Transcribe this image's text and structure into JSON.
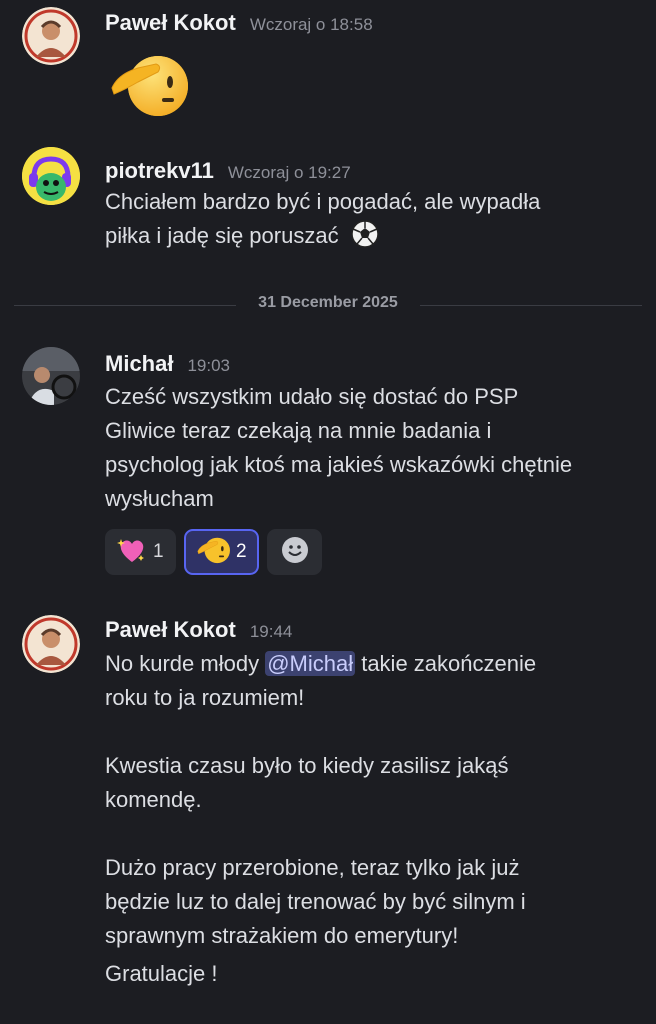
{
  "messages": [
    {
      "author": "Paweł Kokot",
      "time": "Wczoraj o 18:58",
      "emoji": "saluting-face"
    },
    {
      "author": "piotrekv11",
      "time": "Wczoraj o 19:27",
      "text": [
        "Chciałem bardzo być i pogadać, ale wypadła",
        "piłka i jadę się poruszać"
      ]
    },
    {
      "author": "Michał",
      "time": "19:03",
      "text": [
        "Cześć wszystkim udało się dostać do PSP",
        "Gliwice teraz czekają na mnie badania i",
        "psycholog jak ktoś ma jakieś wskazówki chętnie",
        "wysłucham"
      ],
      "reactions": [
        {
          "emoji": "sparkling-heart",
          "count": "1",
          "active": false
        },
        {
          "emoji": "saluting-face",
          "count": "2",
          "active": true
        }
      ]
    },
    {
      "author": "Paweł Kokot",
      "time": "19:44",
      "line1_before": "No kurde młody ",
      "mention": "@Michał",
      "line1_after": " takie zakończenie",
      "line2": "roku to ja rozumiem!",
      "para2": [
        "Kwestia czasu było to kiedy zasilisz jakąś",
        "komendę."
      ],
      "para3": [
        "Dużo pracy przerobione, teraz tylko jak już",
        "będzie luz to dalej trenować by być silnym i",
        "sprawnym strażakiem do emerytury!"
      ],
      "closing": "Gratulacje !"
    }
  ],
  "divider": "31 December 2025",
  "colors": {
    "background": "#1c1d22",
    "mention_bg": "#3c4270",
    "accent": "#5865f2"
  }
}
